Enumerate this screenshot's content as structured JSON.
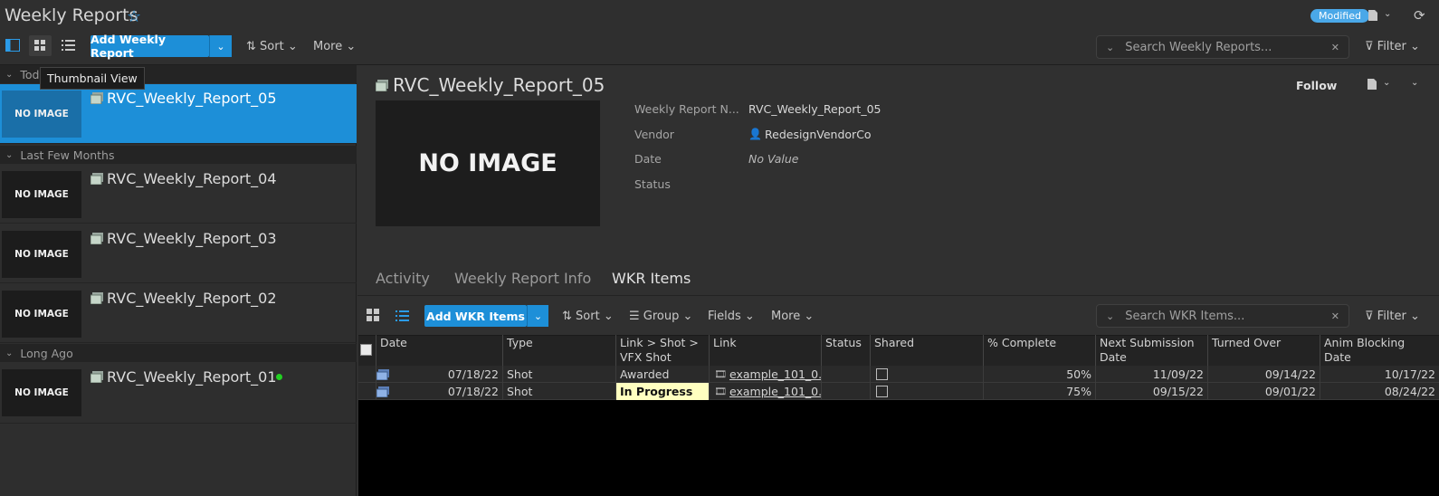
{
  "header": {
    "title": "Weekly Reports",
    "modified_badge": "Modified",
    "add_button": "Add Weekly Report",
    "sort": "Sort",
    "more": "More",
    "search_placeholder": "Search Weekly Reports...",
    "filter": "Filter"
  },
  "tooltip": "Thumbnail View",
  "left": {
    "groups": [
      {
        "label": "Toda"
      },
      {
        "label": "Last Few Months"
      },
      {
        "label": "Long Ago"
      }
    ],
    "cards": [
      {
        "title": "RVC_Weekly_Report_05",
        "thumb": "NO IMAGE"
      },
      {
        "title": "RVC_Weekly_Report_04",
        "thumb": "NO IMAGE"
      },
      {
        "title": "RVC_Weekly_Report_03",
        "thumb": "NO IMAGE"
      },
      {
        "title": "RVC_Weekly_Report_02",
        "thumb": "NO IMAGE"
      },
      {
        "title": "RVC_Weekly_Report_01",
        "thumb": "NO IMAGE"
      }
    ]
  },
  "detail": {
    "title": "RVC_Weekly_Report_05",
    "thumb": "NO IMAGE",
    "follow": "Follow",
    "fields": [
      {
        "label": "Weekly Report N...",
        "value": "RVC_Weekly_Report_05"
      },
      {
        "label": "Vendor",
        "value": "RedesignVendorCo"
      },
      {
        "label": "Date",
        "value": "No Value"
      },
      {
        "label": "Status",
        "value": ""
      }
    ],
    "tabs": [
      "Activity",
      "Weekly Report Info",
      "WKR Items"
    ]
  },
  "items": {
    "add_button": "Add WKR Items",
    "sort": "Sort",
    "group": "Group",
    "fields": "Fields",
    "more": "More",
    "search_placeholder": "Search WKR Items...",
    "filter": "Filter",
    "columns": [
      "Date",
      "Type",
      "Link > Shot >\nVFX Shot Status",
      "Link",
      "Status",
      "Shared",
      "% Complete",
      "Next Submission\nDate",
      "Turned Over",
      "Anim Blocking Date"
    ],
    "rows": [
      {
        "date": "07/18/22",
        "type": "Shot",
        "vfx_status": "Awarded",
        "link": "example_101_0...",
        "status": "",
        "complete": "50%",
        "next_sub": "11/09/22",
        "turned_over": "09/14/22",
        "anim_block": "10/17/22"
      },
      {
        "date": "07/18/22",
        "type": "Shot",
        "vfx_status": "In Progress",
        "link": "example_101_0...",
        "status": "",
        "complete": "75%",
        "next_sub": "09/15/22",
        "turned_over": "09/01/22",
        "anim_block": "08/24/22"
      }
    ]
  },
  "colors": {
    "accent": "#1d8fd8",
    "star": "#2b9be8",
    "in_progress_bg": "#ffffc0",
    "online_dot": "#22d022"
  }
}
